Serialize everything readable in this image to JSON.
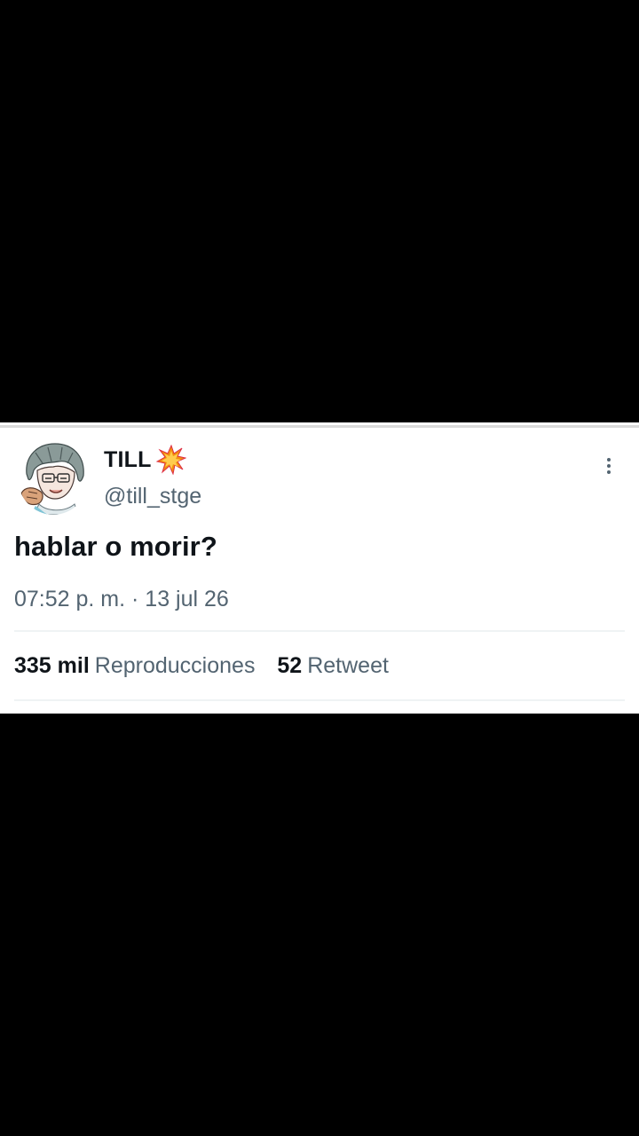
{
  "tweet": {
    "display_name": "TILL",
    "name_emoji": "collision-emoji",
    "handle": "@till_stge",
    "text": "hablar o morir?",
    "timestamp": "07:52 p. m. · 13 jul 26",
    "stats": {
      "views_count": "335 mil",
      "views_label": "Reproducciones",
      "retweets_count": "52",
      "retweets_label": "Retweet"
    }
  },
  "icons": {
    "more": "more-vertical-icon",
    "avatar": "avatar-anime-character"
  },
  "colors": {
    "background": "#000000",
    "card": "#ffffff",
    "primary_text": "#0f1419",
    "secondary_text": "#536471",
    "divider": "#eff3f4",
    "emoji_orange": "#f4900c",
    "emoji_yellow": "#ffcc4d",
    "emoji_red": "#dd2e44"
  }
}
